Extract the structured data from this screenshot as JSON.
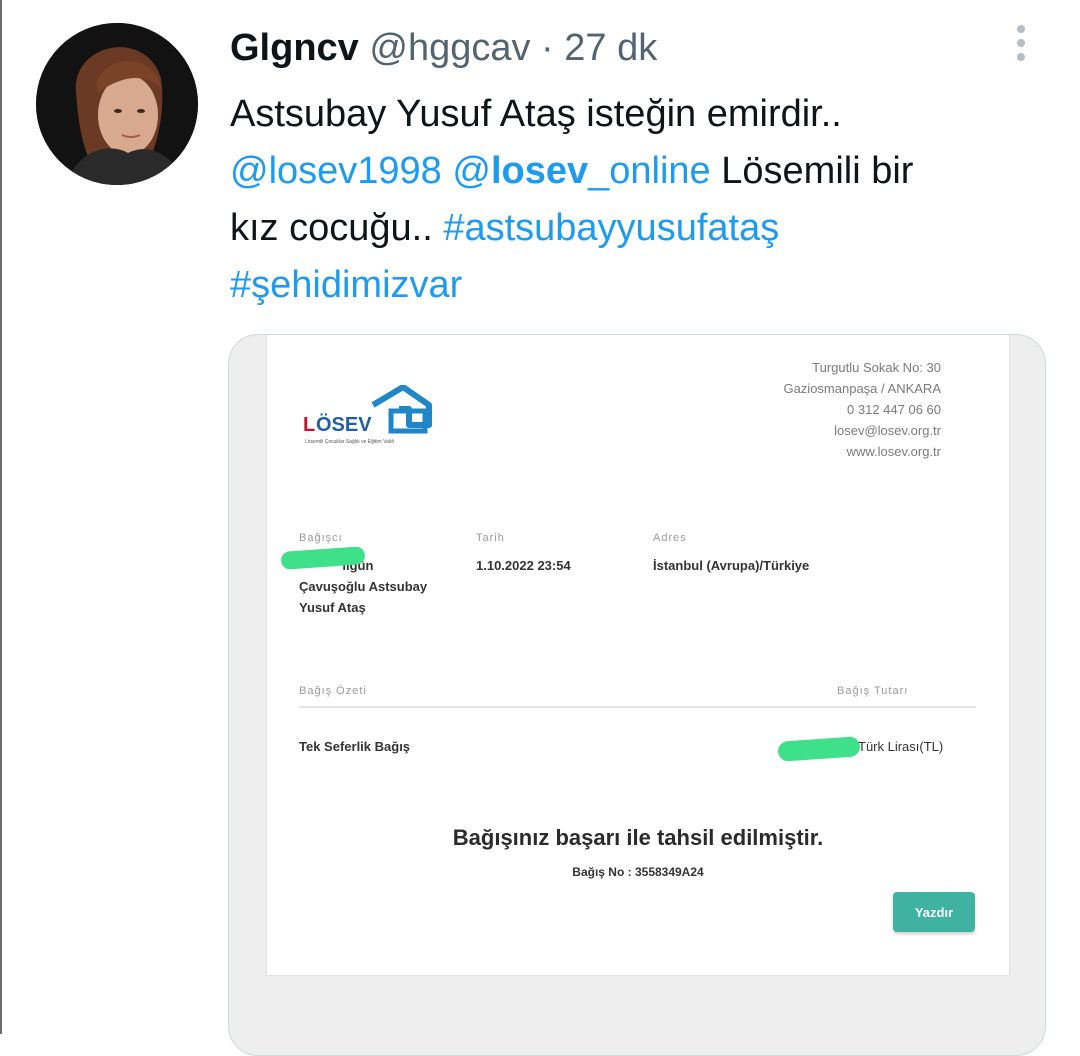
{
  "tweet": {
    "display_name": "Glgncv",
    "handle": "@hggcav",
    "separator": " · ",
    "time": "27 dk",
    "line1": "Astsubay Yusuf Ataş isteğin emirdir..",
    "mention1": "@losev1998",
    "mention2_at": "@",
    "mention2_bold": "losev",
    "mention2_rest": "_online",
    "after_mentions": " Lösemili bir",
    "line3_text": "kız cocuğu.. ",
    "hashtag1": "#astsubayyusufataş",
    "hashtag2": "#şehidimizvar"
  },
  "receipt": {
    "org": {
      "address1": "Turgutlu Sokak No: 30",
      "address2": "Gaziosmanpaşa / ANKARA",
      "phone": "0 312 447 06 60",
      "email": "losev@losev.org.tr",
      "web": "www.losev.org.tr",
      "logo_text": "LÖSEV",
      "logo_tagline": "Lösemili Çocuklar Sağlık ve Eğitim Vakfı"
    },
    "labels": {
      "donor": "Bağışcı",
      "date": "Tarih",
      "address": "Adres",
      "summary": "Bağış Özeti",
      "amount": "Bağış Tutarı"
    },
    "donor_line1": "ılgün",
    "donor_line2": "Çavuşoğlu Astsubay",
    "donor_line3": "Yusuf Ataş",
    "date": "1.10.2022 23:54",
    "address": "İstanbul (Avrupa)/Türkiye",
    "donation_type": "Tek Seferlik Bağış",
    "currency": "Türk Lirası(TL)",
    "success_message": "Bağışınız başarı ile tahsil edilmiştir.",
    "donation_no": "Bağış No : 3558349A24",
    "print_button": "Yazdır"
  },
  "colors": {
    "link": "#1d9bf0",
    "redaction": "#3ee08a",
    "button": "#3fb2a2",
    "logo_red": "#c8102e",
    "logo_blue": "#1f86c8"
  }
}
